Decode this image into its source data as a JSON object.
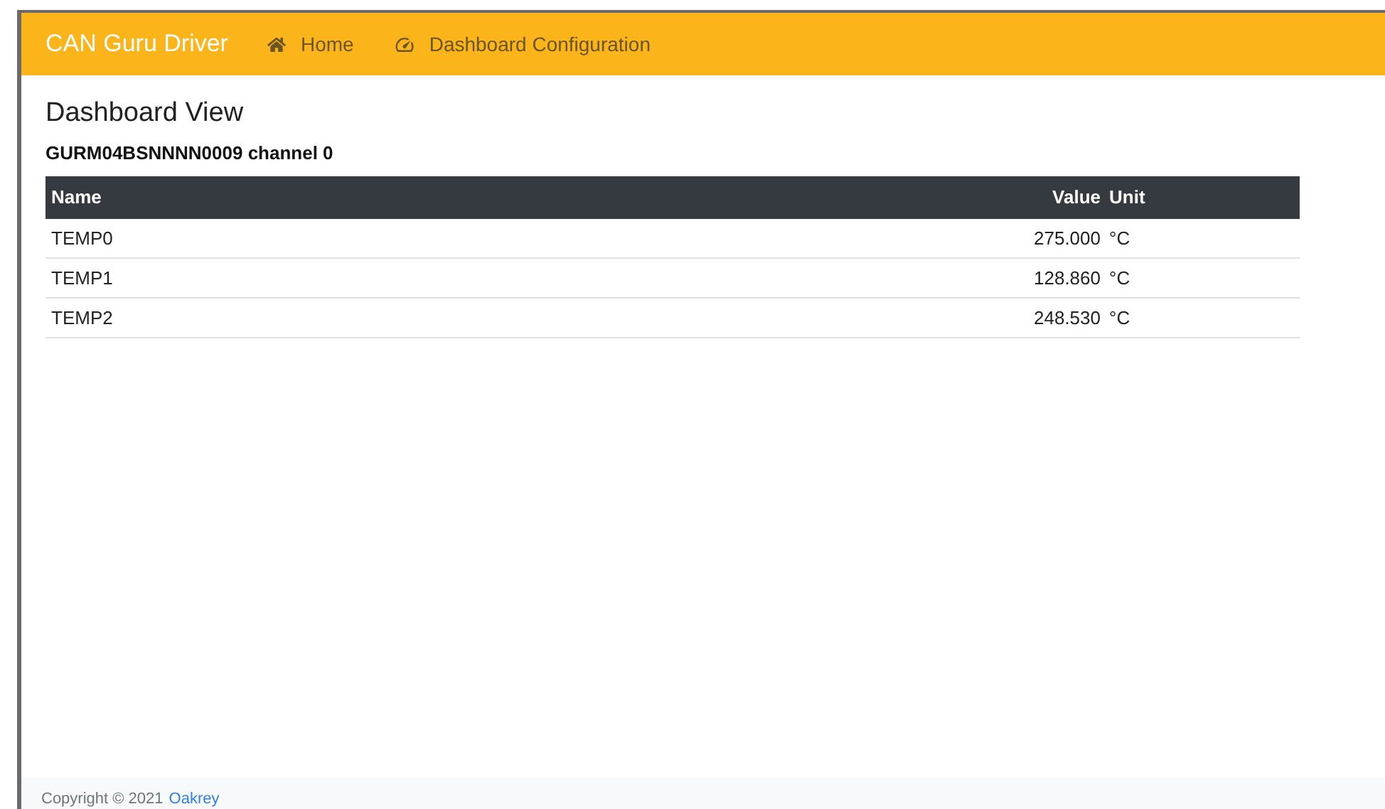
{
  "navbar": {
    "brand": "CAN Guru Driver",
    "links": [
      {
        "kind": "home",
        "label": "Home"
      },
      {
        "kind": "dashboard",
        "label": "Dashboard Configuration"
      }
    ]
  },
  "page": {
    "title": "Dashboard View",
    "subtitle": "GURM04BSNNNN0009 channel 0"
  },
  "table": {
    "columns": [
      "Name",
      "Value",
      "Unit"
    ],
    "rows": [
      [
        "TEMP0",
        "275.000",
        "°C"
      ],
      [
        "TEMP1",
        "128.860",
        "°C"
      ],
      [
        "TEMP2",
        "248.530",
        "°C"
      ]
    ]
  },
  "footer": {
    "text": "Copyright © 2021",
    "link": "Oakrey"
  }
}
